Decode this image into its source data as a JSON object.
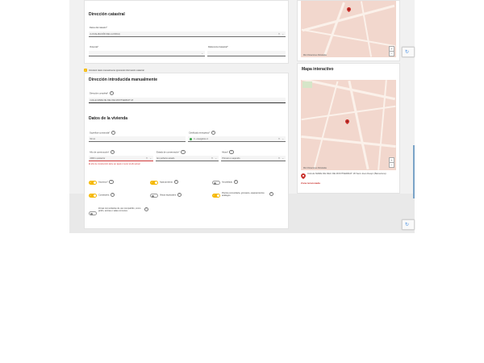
{
  "catastral": {
    "title": "Dirección catastral",
    "municipio_label": "Datos del catastro*",
    "municipio_value": "(LOCALIZACIÓN DE LA FINCA)",
    "vivienda_label": "Vivienda*",
    "vivienda_value": "",
    "referencia_label": "Referencia Catastral*",
    "referencia_value": ""
  },
  "manual": {
    "check_text": "Introducir datos manualmente ignorando información catastral",
    "title": "Dirección introducida manualmente",
    "direccion_label": "Dirección completa*",
    "direccion_value": "CALLE MARE DE DEU DE MONTSERRAT 18"
  },
  "vivienda": {
    "title": "Datos de la vivienda",
    "superficie_label": "Superficie construida*",
    "superficie_value": "50 m²",
    "certificado_label": "Certificado energético*",
    "certificado_value": "C- energético 4",
    "anio_label": "Año de construcción*",
    "anio_value": "2000 o posterior",
    "anio_error": "El año de construcción debe ser igual o menor al año actual",
    "estado_label": "Estado de conservación*",
    "estado_value": "En perfecto estado",
    "altura_label": "Altura*",
    "altura_value": "Primero o segundo",
    "toggles": [
      {
        "label": "Ascensor*",
        "state": "on"
      },
      {
        "label": "Aparcamiento",
        "state": "on"
      },
      {
        "label": "Amueblado",
        "state": "off"
      },
      {
        "label": "Conserjería",
        "state": "on"
      },
      {
        "label": "Vistas especiales",
        "state": "off"
      },
      {
        "label": "Piscina comunitaria, gimnasio, equipamientos análogos",
        "state": "on"
      },
      {
        "label": "Zonas comunitarias de uso compartido, como jardín, azotea o salas comunes",
        "state": "off"
      }
    ]
  },
  "map": {
    "title": "Mapa interactivo",
    "scale_label": "Mis Ubicaciones Rotuladas",
    "zoom_in": "+",
    "zoom_out": "−",
    "google": "Google",
    "address": "CALLE MARE DE DEU DE MONTSERRAT 18 Sant Joan Despí (Barcelona)",
    "zona": "Zona tensionada"
  },
  "icons": {
    "help": "?",
    "clear": "×",
    "caret": "⌄",
    "check": "✓",
    "pin": "location-pin-icon",
    "recaptcha": "recaptcha-icon"
  },
  "colors": {
    "accent": "#f5b800",
    "error": "#d13b3b",
    "map_base": "#f2d7cd",
    "pin": "#c9302c"
  }
}
